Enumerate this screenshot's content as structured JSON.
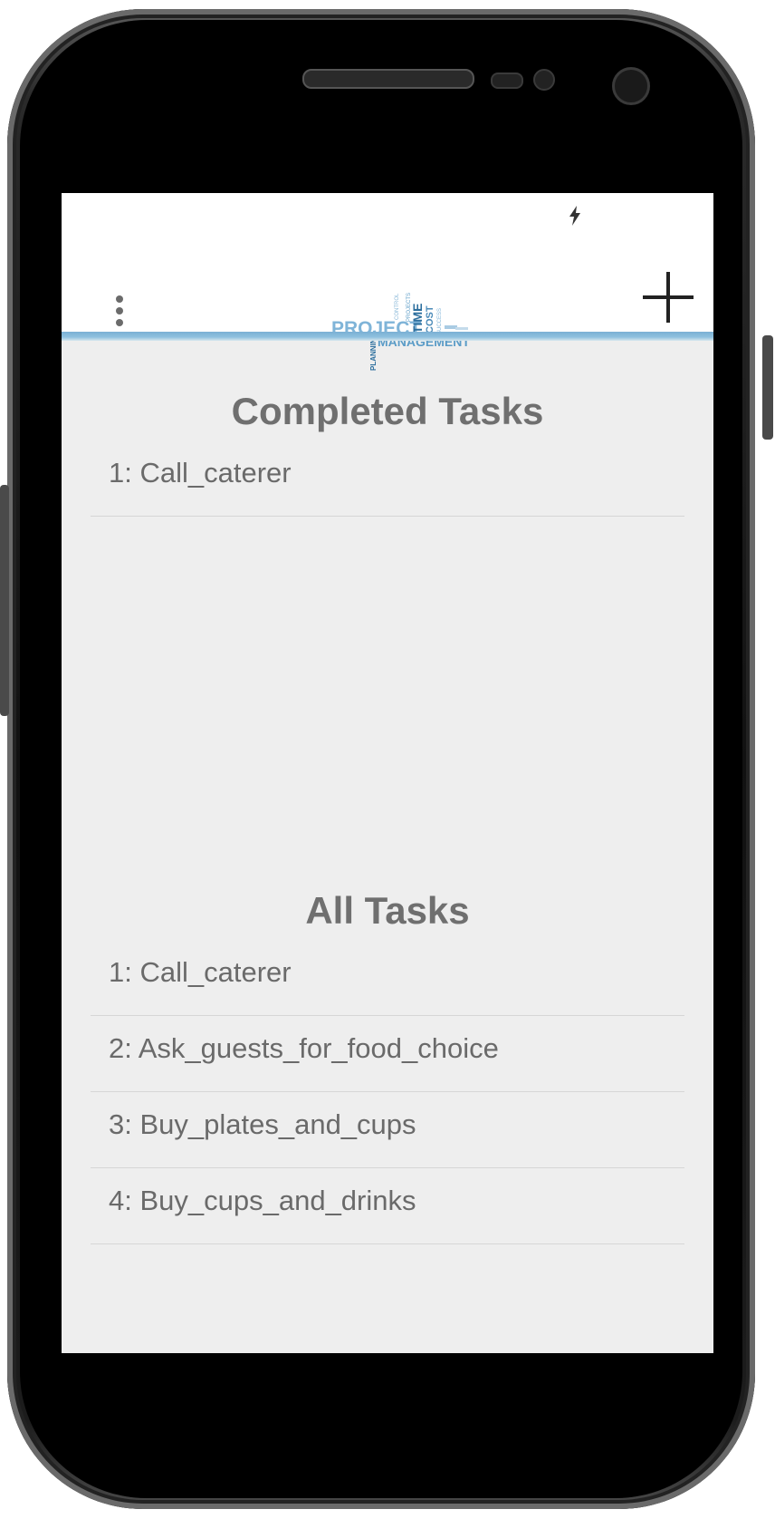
{
  "appbar": {
    "logo_words": [
      "PROJECT",
      "MANAGEMENT",
      "TIME",
      "COST",
      "PLANNING",
      "CONTROL",
      "PROJECTS",
      "SUCCESS"
    ]
  },
  "completed": {
    "title": "Completed Tasks",
    "tasks": [
      "1: Call_caterer"
    ]
  },
  "all": {
    "title": "All Tasks",
    "tasks": [
      "1: Call_caterer",
      "2: Ask_guests_for_food_choice",
      "3: Buy_plates_and_cups",
      "4: Buy_cups_and_drinks"
    ]
  }
}
